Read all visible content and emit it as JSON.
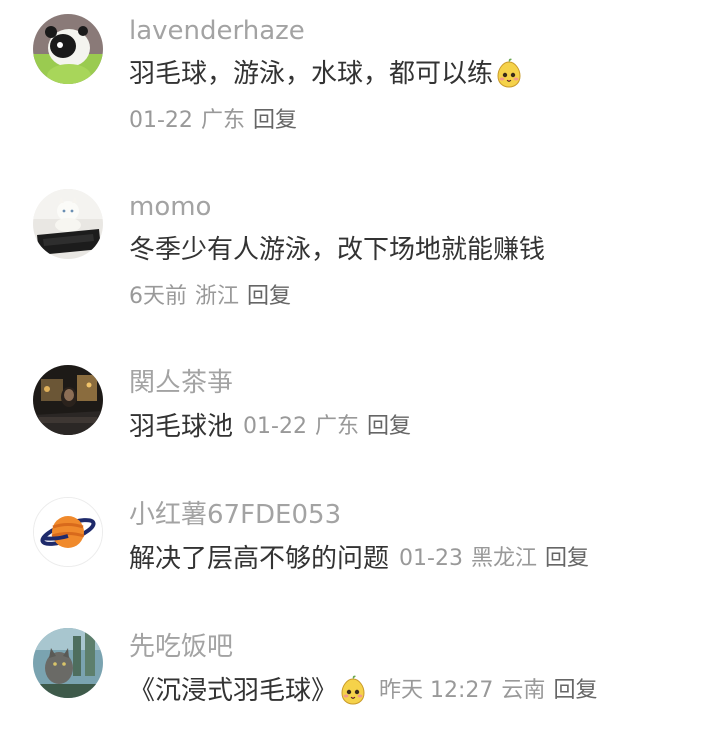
{
  "comments": [
    {
      "username": "lavenderhaze",
      "text": "羽毛球，游泳，水球，都可以练",
      "emoji": "cute-pear-emoji",
      "date": "01-22",
      "location": "广东",
      "reply": "回复",
      "avatar_icon": "panda-avatar"
    },
    {
      "username": "momo",
      "text": "冬季少有人游泳，改下场地就能赚钱",
      "date": "6天前",
      "location": "浙江",
      "reply": "回复",
      "avatar_icon": "cat-laptop-avatar"
    },
    {
      "username": "関亼茶亊",
      "text": "羽毛球池",
      "date": "01-22",
      "location": "广东",
      "reply": "回复",
      "avatar_icon": "car-night-avatar"
    },
    {
      "username": "小红薯67FDE053",
      "text": "解决了层高不够的问题",
      "date": "01-23",
      "location": "黑龙江",
      "reply": "回复",
      "avatar_icon": "planet-avatar"
    },
    {
      "username": "先吃饭吧",
      "text": "《沉浸式羽毛球》",
      "emoji": "cute-pear-emoji",
      "date": "昨天 12:27",
      "location": "云南",
      "reply": "回复",
      "avatar_icon": "cat-outdoor-avatar"
    }
  ],
  "colors": {
    "username": "#a3a3a3",
    "text": "#333333",
    "meta": "#999999",
    "planet": "#f08a2c"
  }
}
